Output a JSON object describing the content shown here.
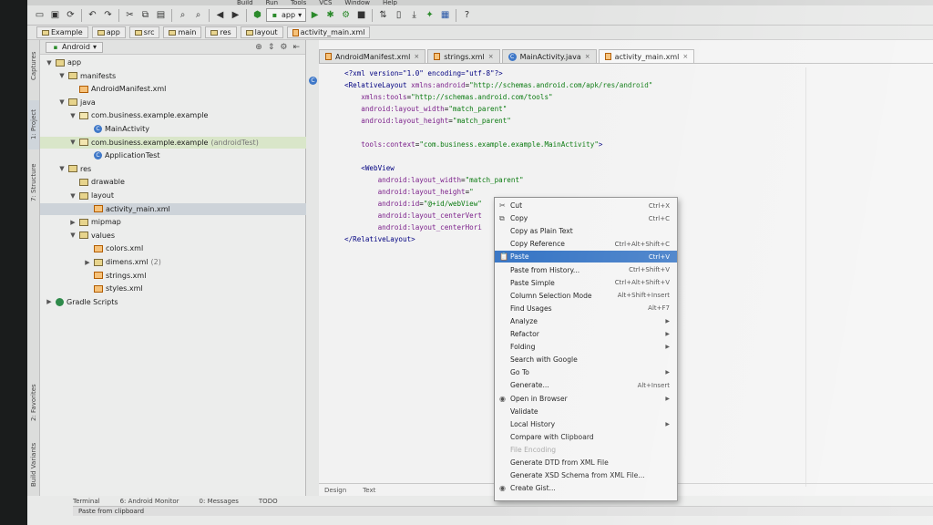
{
  "menubar": [
    "Build",
    "Run",
    "Tools",
    "VCS",
    "Window",
    "Help"
  ],
  "toolbar": {
    "run_config": "app",
    "help_icon": "?"
  },
  "breadcrumbs": [
    "Example",
    "app",
    "src",
    "main",
    "res",
    "layout",
    "activity_main.xml"
  ],
  "project_panel": {
    "view_selector": "Android",
    "tree": [
      {
        "label": "app",
        "kind": "folder",
        "arrow": "▼"
      },
      {
        "label": "manifests",
        "kind": "folder",
        "arrow": "▼"
      },
      {
        "label": "AndroidManifest.xml",
        "kind": "xml",
        "arrow": ""
      },
      {
        "label": "java",
        "kind": "folder",
        "arrow": "▼"
      },
      {
        "label": "com.business.example.example",
        "kind": "pkg",
        "arrow": "▼"
      },
      {
        "label": "MainActivity",
        "kind": "cls",
        "arrow": ""
      },
      {
        "label": "com.business.example.example",
        "extra": "(androidTest)",
        "kind": "pkg",
        "arrow": "▼"
      },
      {
        "label": "ApplicationTest",
        "kind": "cls",
        "arrow": ""
      },
      {
        "label": "res",
        "kind": "folder",
        "arrow": "▼"
      },
      {
        "label": "drawable",
        "kind": "folder",
        "arrow": ""
      },
      {
        "label": "layout",
        "kind": "folder",
        "arrow": "▼"
      },
      {
        "label": "activity_main.xml",
        "kind": "xml",
        "arrow": ""
      },
      {
        "label": "mipmap",
        "kind": "folder",
        "arrow": "▶"
      },
      {
        "label": "values",
        "kind": "folder",
        "arrow": "▼"
      },
      {
        "label": "colors.xml",
        "kind": "xml",
        "arrow": ""
      },
      {
        "label": "dimens.xml",
        "extra": "(2)",
        "kind": "folder",
        "arrow": "▶"
      },
      {
        "label": "strings.xml",
        "kind": "xml",
        "arrow": ""
      },
      {
        "label": "styles.xml",
        "kind": "xml",
        "arrow": ""
      },
      {
        "label": "Gradle Scripts",
        "kind": "gradle",
        "arrow": "▶"
      }
    ]
  },
  "side_tabs": {
    "captures": "Captures",
    "project": "1: Project",
    "structure": "7: Structure",
    "favorites": "2: Favorites",
    "build_variants": "Build Variants"
  },
  "editor": {
    "tabs": [
      {
        "label": "AndroidManifest.xml",
        "icon": "xml"
      },
      {
        "label": "strings.xml",
        "icon": "xml"
      },
      {
        "label": "MainActivity.java",
        "icon": "cls"
      },
      {
        "label": "activity_main.xml",
        "icon": "xml"
      }
    ],
    "lines": [
      [
        {
          "t": "<?xml version=\"1.0\" encoding=\"utf-8\"?>",
          "c": "tag"
        }
      ],
      [
        {
          "t": "<RelativeLayout ",
          "c": "tag"
        },
        {
          "t": "xmlns:android",
          "c": "an"
        },
        {
          "t": "=",
          "c": ""
        },
        {
          "t": "\"http://schemas.android.com/apk/res/android\"",
          "c": "av"
        }
      ],
      [
        {
          "t": "    xmlns:tools",
          "c": "an"
        },
        {
          "t": "=",
          "c": ""
        },
        {
          "t": "\"http://schemas.android.com/tools\"",
          "c": "av"
        }
      ],
      [
        {
          "t": "    android:layout_width",
          "c": "an"
        },
        {
          "t": "=",
          "c": ""
        },
        {
          "t": "\"match_parent\"",
          "c": "av"
        }
      ],
      [
        {
          "t": "    android:layout_height",
          "c": "an"
        },
        {
          "t": "=",
          "c": ""
        },
        {
          "t": "\"match_parent\"",
          "c": "av"
        }
      ],
      [
        {
          "t": "",
          "c": ""
        }
      ],
      [
        {
          "t": "    tools:context",
          "c": "an"
        },
        {
          "t": "=",
          "c": ""
        },
        {
          "t": "\"com.business.example.example.MainActivity\"",
          "c": "av"
        },
        {
          "t": ">",
          "c": "tag"
        }
      ],
      [
        {
          "t": "",
          "c": ""
        }
      ],
      [
        {
          "t": "    <WebView",
          "c": "tag"
        }
      ],
      [
        {
          "t": "        android:layout_width",
          "c": "an"
        },
        {
          "t": "=",
          "c": ""
        },
        {
          "t": "\"match_parent\"",
          "c": "av"
        }
      ],
      [
        {
          "t": "        android:layout_height",
          "c": "an"
        },
        {
          "t": "=",
          "c": ""
        },
        {
          "t": "\"",
          "c": "av"
        }
      ],
      [
        {
          "t": "        android:id",
          "c": "an"
        },
        {
          "t": "=",
          "c": ""
        },
        {
          "t": "\"@+id/webView\"",
          "c": "av"
        }
      ],
      [
        {
          "t": "        android:layout_centerVert",
          "c": "an"
        }
      ],
      [
        {
          "t": "        android:layout_centerHori",
          "c": "an"
        }
      ],
      [
        {
          "t": "</RelativeLayout>",
          "c": "tag"
        }
      ]
    ],
    "footer_tabs": [
      "Design",
      "Text"
    ]
  },
  "context_menu": {
    "items": [
      {
        "label": "Cut",
        "shortcut": "Ctrl+X",
        "icon": "✂"
      },
      {
        "label": "Copy",
        "shortcut": "Ctrl+C",
        "icon": "⧉"
      },
      {
        "label": "Copy as Plain Text",
        "shortcut": ""
      },
      {
        "label": "Copy Reference",
        "shortcut": "Ctrl+Alt+Shift+C"
      },
      {
        "label": "Paste",
        "shortcut": "Ctrl+V",
        "icon": "📋",
        "highlighted": true
      },
      {
        "label": "Paste from History...",
        "shortcut": "Ctrl+Shift+V"
      },
      {
        "label": "Paste Simple",
        "shortcut": "Ctrl+Alt+Shift+V"
      },
      {
        "label": "Column Selection Mode",
        "shortcut": "Alt+Shift+Insert"
      },
      {
        "label": "Find Usages",
        "shortcut": "Alt+F7"
      },
      {
        "label": "Analyze",
        "submenu": true
      },
      {
        "label": "Refactor",
        "submenu": true
      },
      {
        "label": "Folding",
        "submenu": true
      },
      {
        "label": "Search with Google",
        "shortcut": ""
      },
      {
        "label": "Go To",
        "submenu": true
      },
      {
        "label": "Generate...",
        "shortcut": "Alt+Insert"
      },
      {
        "label": "Open in Browser",
        "submenu": true,
        "icon": "◉"
      },
      {
        "label": "Validate",
        "shortcut": ""
      },
      {
        "label": "Local History",
        "submenu": true
      },
      {
        "label": "Compare with Clipboard",
        "shortcut": ""
      },
      {
        "label": "File Encoding",
        "shortcut": "",
        "disabled": true
      },
      {
        "label": "Generate DTD from XML File",
        "shortcut": ""
      },
      {
        "label": "Generate XSD Schema from XML File...",
        "shortcut": ""
      },
      {
        "label": "Create Gist...",
        "shortcut": "",
        "icon": "◉"
      }
    ]
  },
  "bottom_tabs": [
    "Terminal",
    "6: Android Monitor",
    "0: Messages",
    "TODO"
  ],
  "status": {
    "message": "Paste from clipboard"
  },
  "colors": {
    "selection": "#3b78c6",
    "xml_tag": "#000080",
    "xml_attr": "#7b1f8a",
    "xml_value": "#0a7a10"
  }
}
